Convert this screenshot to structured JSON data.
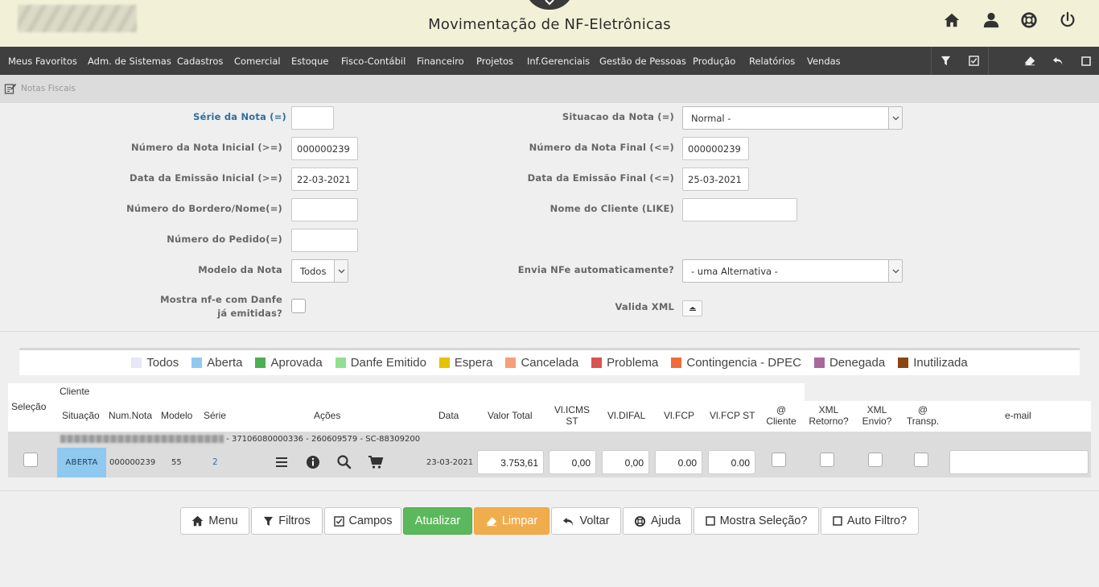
{
  "header": {
    "title": "Movimentação de NF-Eletrônicas",
    "icons": [
      "home-icon",
      "user-icon",
      "lifebuoy-icon",
      "power-icon"
    ]
  },
  "menu": {
    "items": [
      "Meus Favoritos",
      "Adm. de Sistemas",
      "Cadastros",
      "Comercial",
      "Estoque",
      "Fisco-Contábil",
      "Financeiro",
      "Projetos",
      "Inf.Gerenciais",
      "Gestão de Pessoas",
      "Produção",
      "Relatórios",
      "Vendas"
    ],
    "tools": [
      "filter-icon",
      "checkbox-icon",
      "eraser-icon",
      "undo-icon",
      "window-icon"
    ]
  },
  "breadcrumb": {
    "text": "Notas Fiscais"
  },
  "form": {
    "serie_label": "Série da Nota (=)",
    "serie_value": "",
    "situacao_label": "Situacao da Nota (=)",
    "situacao_value": "Normal -",
    "num_ini_label": "Número da Nota Inicial (>=)",
    "num_ini_value": "000000239",
    "num_fin_label": "Número da Nota Final (<=)",
    "num_fin_value": "000000239",
    "data_ini_label": "Data da Emissão Inicial (>=)",
    "data_ini_value": "22-03-2021",
    "data_fin_label": "Data da Emissão Final (<=)",
    "data_fin_value": "25-03-2021",
    "bordero_label": "Número do Bordero/Nome(=)",
    "bordero_value": "",
    "cliente_label": "Nome do Cliente (LIKE)",
    "cliente_value": "",
    "pedido_label": "Número do Pedido(=)",
    "pedido_value": "",
    "modelo_label": "Modelo da Nota",
    "modelo_value": "Todos",
    "envia_label": "Envia NFe automaticamente?",
    "envia_value": "- uma Alternativa -",
    "mostra_label": "Mostra nf-e com Danfe já emitidas?",
    "valida_label": "Valida XML"
  },
  "legend": [
    {
      "label": "Todos",
      "color": "#e6e6f5"
    },
    {
      "label": "Aberta",
      "color": "#8fc9f0"
    },
    {
      "label": "Aprovada",
      "color": "#4caf50"
    },
    {
      "label": "Danfe Emitido",
      "color": "#90e090"
    },
    {
      "label": "Espera",
      "color": "#e6c200"
    },
    {
      "label": "Cancelada",
      "color": "#f4a07a"
    },
    {
      "label": "Problema",
      "color": "#d9534f"
    },
    {
      "label": "Contingencia - DPEC",
      "color": "#f06a3a"
    },
    {
      "label": "Denegada",
      "color": "#a8689c"
    },
    {
      "label": "Inutilizada",
      "color": "#8b4513"
    }
  ],
  "table": {
    "headers": {
      "selecao": "Seleção",
      "cliente": "Cliente",
      "situacao": "Situação",
      "num_nota": "Num.Nota",
      "modelo": "Modelo",
      "serie": "Série",
      "acoes": "Ações",
      "data": "Data",
      "valor_total": "Valor Total",
      "vl_icms_st_1": "Vl.ICMS",
      "vl_icms_st_2": "ST",
      "vl_difal": "Vl.DIFAL",
      "vl_fcp": "Vl.FCP",
      "vl_fcp_st": "Vl.FCP ST",
      "at_cliente_1": "@",
      "at_cliente_2": "Cliente",
      "xml_retorno_1": "XML",
      "xml_retorno_2": "Retorno?",
      "xml_envio_1": "XML",
      "xml_envio_2": "Envio?",
      "at_transp_1": "@",
      "at_transp_2": "Transp.",
      "email": "e-mail"
    },
    "row": {
      "cliente_suffix": "- 37106080000336 - 260609579 - SC-88309200",
      "situacao": "ABERTA",
      "num_nota": "000000239",
      "modelo": "55",
      "serie": "2",
      "data": "23-03-2021",
      "valor_total": "3.753,61",
      "vl_icms_st": "0,00",
      "vl_difal": "0,00",
      "vl_fcp": "0.00",
      "vl_fcp_st": "0.00",
      "email": ""
    }
  },
  "buttons": {
    "menu": "Menu",
    "filtros": "Filtros",
    "campos": "Campos",
    "atualizar": "Atualizar",
    "limpar": "Limpar",
    "voltar": "Voltar",
    "ajuda": "Ajuda",
    "mostra_selecao": "Mostra Seleção?",
    "auto_filtro": "Auto Filtro?"
  }
}
